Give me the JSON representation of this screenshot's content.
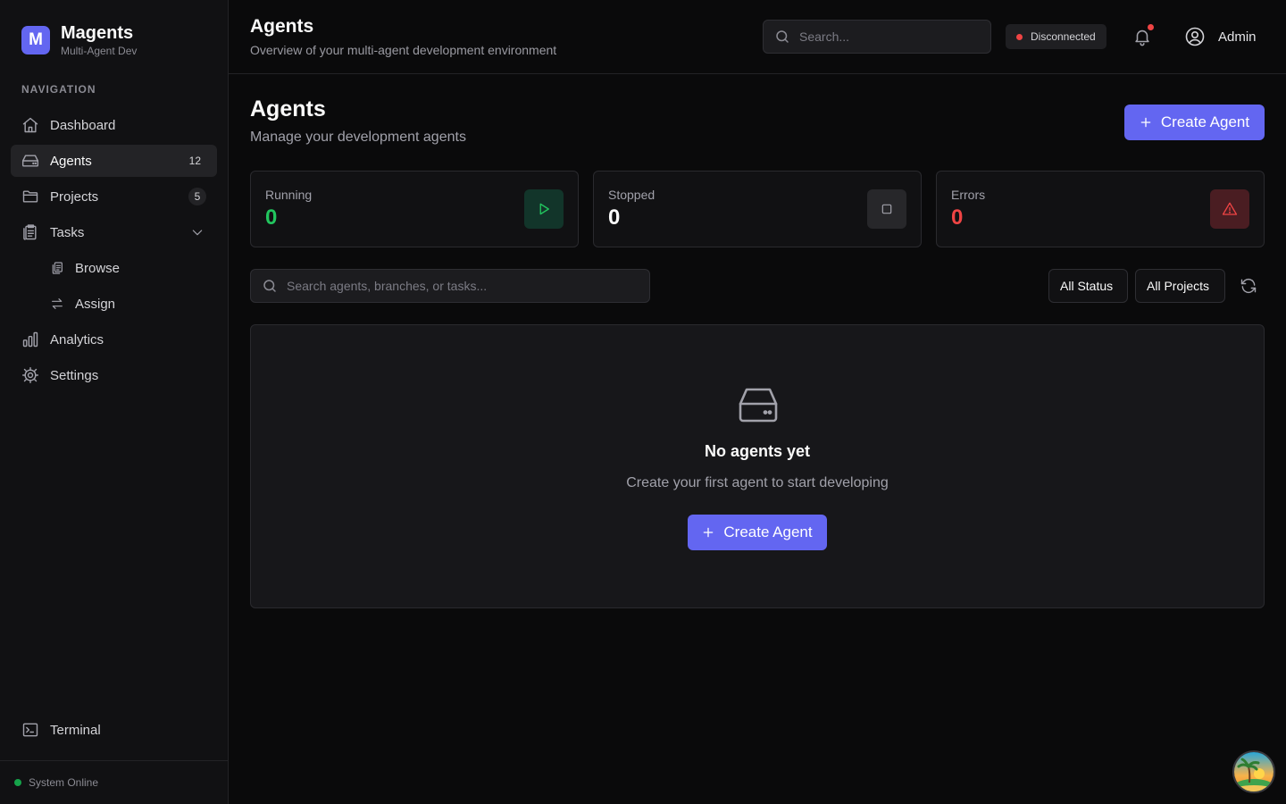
{
  "brand": {
    "logo_letter": "M",
    "name": "Magents",
    "subtitle": "Multi-Agent Dev"
  },
  "sidebar": {
    "heading": "NAVIGATION",
    "items": [
      {
        "label": "Dashboard",
        "icon": "home-icon"
      },
      {
        "label": "Agents",
        "icon": "hard-drive-icon",
        "count": "12",
        "active": true
      },
      {
        "label": "Projects",
        "icon": "folder-icon",
        "badge": "5"
      },
      {
        "label": "Tasks",
        "icon": "clipboard-icon",
        "expanded": true
      },
      {
        "label": "Browse",
        "icon": "copy-icon",
        "sub": true
      },
      {
        "label": "Assign",
        "icon": "arrows-swap-icon",
        "sub": true
      },
      {
        "label": "Analytics",
        "icon": "bar-chart-icon"
      },
      {
        "label": "Settings",
        "icon": "gear-icon"
      }
    ],
    "terminal_label": "Terminal",
    "footer_status": "System Online"
  },
  "header": {
    "title": "Agents",
    "subtitle": "Overview of your multi-agent development environment",
    "search_placeholder": "Search...",
    "connection_status": "Disconnected",
    "user_name": "Admin"
  },
  "main": {
    "title": "Agents",
    "subtitle": "Manage your development agents",
    "create_button": "Create Agent",
    "stats": [
      {
        "label": "Running",
        "value": "0",
        "color": "#22c55e"
      },
      {
        "label": "Stopped",
        "value": "0",
        "color": "#fafafa"
      },
      {
        "label": "Errors",
        "value": "0",
        "color": "#ef4444"
      }
    ],
    "filter_placeholder": "Search agents, branches, or tasks...",
    "status_filter": "All Status",
    "project_filter": "All Projects",
    "empty_state": {
      "title": "No agents yet",
      "subtitle": "Create your first agent to start developing",
      "button": "Create Agent"
    }
  },
  "colors": {
    "accent": "#6366f1",
    "background": "#0a0a0b",
    "sidebar": "#111113"
  }
}
